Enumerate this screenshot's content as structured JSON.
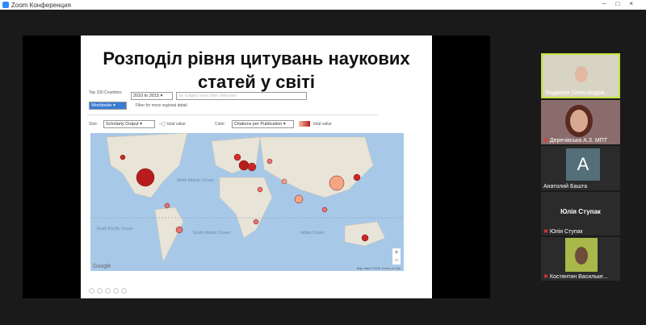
{
  "window": {
    "title": "Zoom Конференция"
  },
  "slide": {
    "title": "Розподіл рівня цитувань наукових статей у світі",
    "top_label": "Top 100 Countries",
    "period_select": "2010 to 2015",
    "subject_placeholder": "no subject area filter selected",
    "region_select": "Worldwide",
    "region_hint": "Filter for more regional detail",
    "size_label": "Size:",
    "size_select": "Scholarly Output",
    "size_legend": "total value",
    "color_label": "Color:",
    "color_select": "Citations per Publication",
    "color_legend": "total value",
    "map_labels": {
      "north_atlantic": "North Atlantic Ocean",
      "south_pacific": "South Pacific Ocean",
      "south_atlantic": "South Atlantic Ocean",
      "indian": "Indian Ocean",
      "google": "Google",
      "zoom_in": "+",
      "zoom_out": "−",
      "footer": "Map data ©2016  Terms of Use"
    }
  },
  "participants": [
    {
      "name": "Людмила  Олександрів...",
      "active": true,
      "muted": false
    },
    {
      "name": "Деречівська А.З. МПТ",
      "muted": true
    },
    {
      "name": "Анатолий Башта",
      "avatar_letter": "A",
      "muted": false
    },
    {
      "name": "Юлія Ступак",
      "center_name": "Юлія Ступак",
      "muted": true
    },
    {
      "name": "Костянтин Васильке...",
      "muted": true
    }
  ],
  "colors": {
    "accent": "#2d8cff",
    "active_border": "#c6e03a",
    "bubble_dark": "#b71c1c",
    "bubble_light": "#f4a582"
  }
}
